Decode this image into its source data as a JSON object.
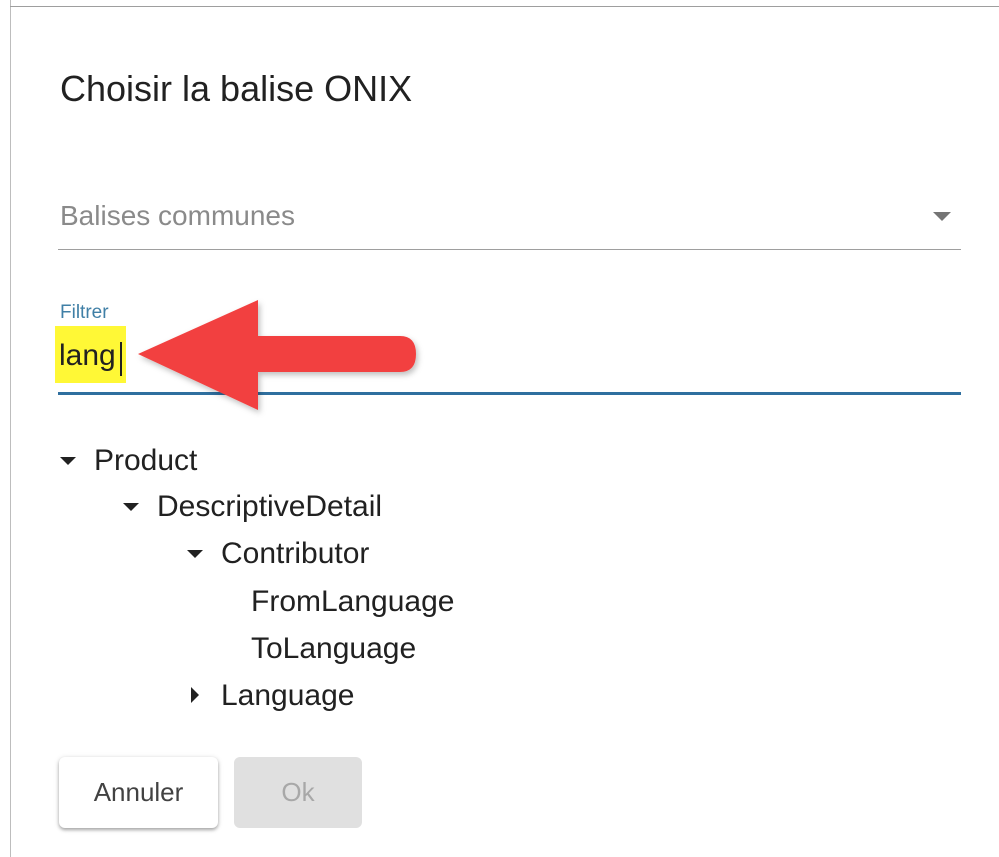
{
  "dialog": {
    "title": "Choisir la balise ONIX"
  },
  "tag_select": {
    "value": "Balises communes"
  },
  "filter": {
    "label": "Filtrer",
    "value": "lang"
  },
  "tree": {
    "items": [
      {
        "label": "Product",
        "toggle": "expanded"
      },
      {
        "label": "DescriptiveDetail",
        "toggle": "expanded"
      },
      {
        "label": "Contributor",
        "toggle": "expanded"
      },
      {
        "label": "FromLanguage",
        "toggle": "none"
      },
      {
        "label": "ToLanguage",
        "toggle": "none"
      },
      {
        "label": "Language",
        "toggle": "collapsed"
      }
    ]
  },
  "buttons": {
    "cancel_label": "Annuler",
    "ok_label": "Ok"
  },
  "colors": {
    "accent": "#2f6f9f",
    "label_accent": "#3f7fa6",
    "highlight": "#fff836",
    "annotation_arrow": "#f2413f"
  }
}
